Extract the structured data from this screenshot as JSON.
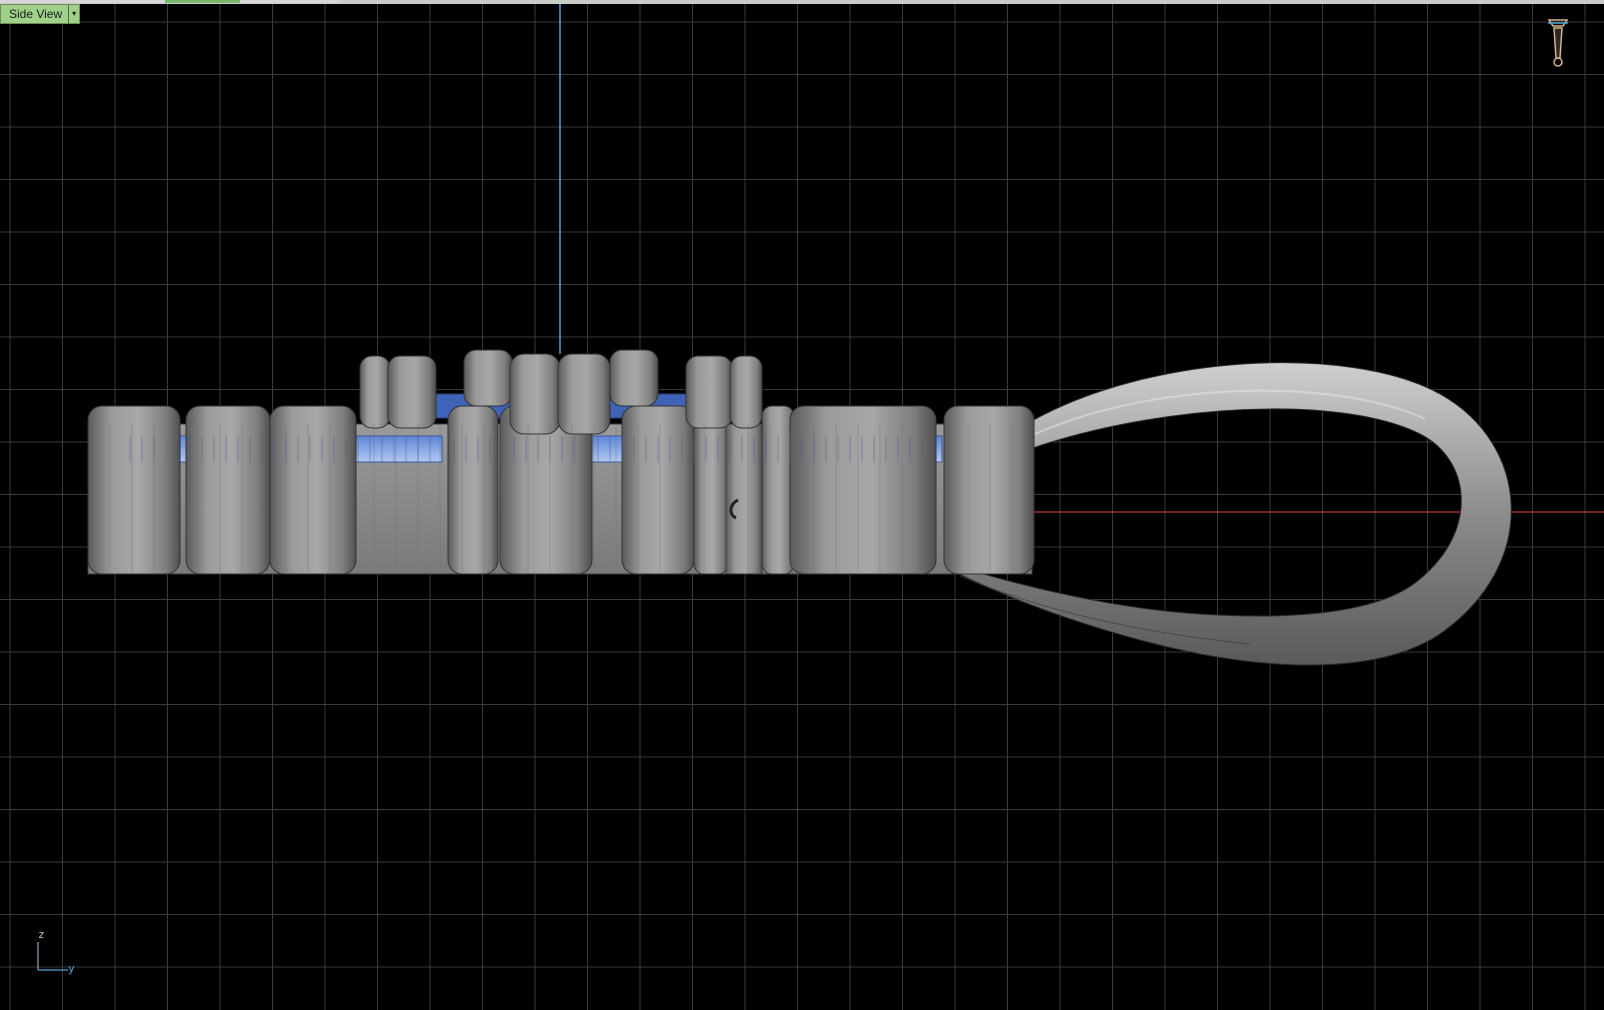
{
  "viewport": {
    "name": "Side View",
    "dropdown_symbol": "▾",
    "colors": {
      "background": "#000000",
      "grid": "#3a3a3a",
      "axis_vertical": "#4aa8d8",
      "axis_horizontal": "#c0392b",
      "model_gray": "#8f8f8f",
      "selected_blue": "#7fa6e8",
      "menu_green": "#9fd18a"
    }
  },
  "axis_triad": {
    "up": "z",
    "right": "y"
  },
  "icons": {
    "camera": "camera-icon",
    "menu": "chevron-down-icon"
  }
}
